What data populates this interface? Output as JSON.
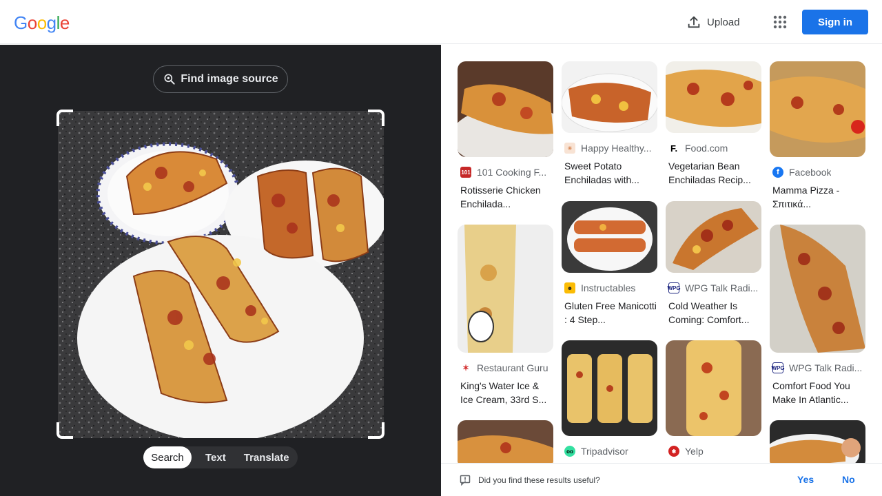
{
  "header": {
    "logo_letters": [
      "G",
      "o",
      "o",
      "g",
      "l",
      "e"
    ],
    "upload_label": "Upload",
    "signin_label": "Sign in"
  },
  "lens": {
    "find_source_label": "Find image source",
    "modes": [
      "Search",
      "Text",
      "Translate"
    ],
    "active_mode": "Search"
  },
  "results": [
    {
      "source": "101 Cooking F...",
      "title": "Rotisserie Chicken Enchilada...",
      "favicon": "101-cooking-favicon"
    },
    {
      "source": "Happy Healthy...",
      "title": "Sweet Potato Enchiladas with...",
      "favicon": "happy-healthy-favicon"
    },
    {
      "source": "Food.com",
      "title": "Vegetarian Bean Enchiladas Recip...",
      "favicon": "food-com-favicon"
    },
    {
      "source": "Facebook",
      "title": "Mamma Pizza - Σπιτικά...",
      "favicon": "facebook-icon"
    },
    {
      "source": "Restaurant Guru",
      "title": "King's Water Ice & Ice Cream, 33rd S...",
      "favicon": "restaurant-guru-favicon"
    },
    {
      "source": "Instructables",
      "title": "Gluten Free Manicotti : 4 Step...",
      "favicon": "instructables-favicon"
    },
    {
      "source": "WPG Talk Radi...",
      "title": "Cold Weather Is Coming: Comfort...",
      "favicon": "wpg-favicon"
    },
    {
      "source": "WPG Talk Radi...",
      "title": "Comfort Food You Make In Atlantic...",
      "favicon": "wpg-favicon"
    },
    {
      "source": "Tripadvisor",
      "title": "",
      "favicon": "tripadvisor-favicon"
    },
    {
      "source": "Yelp",
      "title": "",
      "favicon": "yelp-favicon"
    }
  ],
  "feedback": {
    "question": "Did you find these results useful?",
    "yes_label": "Yes",
    "no_label": "No"
  },
  "colors": {
    "accent": "#1a73e8",
    "panel_dark": "#202124",
    "google_blue": "#4285f4",
    "google_red": "#ea4335",
    "google_yellow": "#fbbc05",
    "google_green": "#34a853"
  }
}
